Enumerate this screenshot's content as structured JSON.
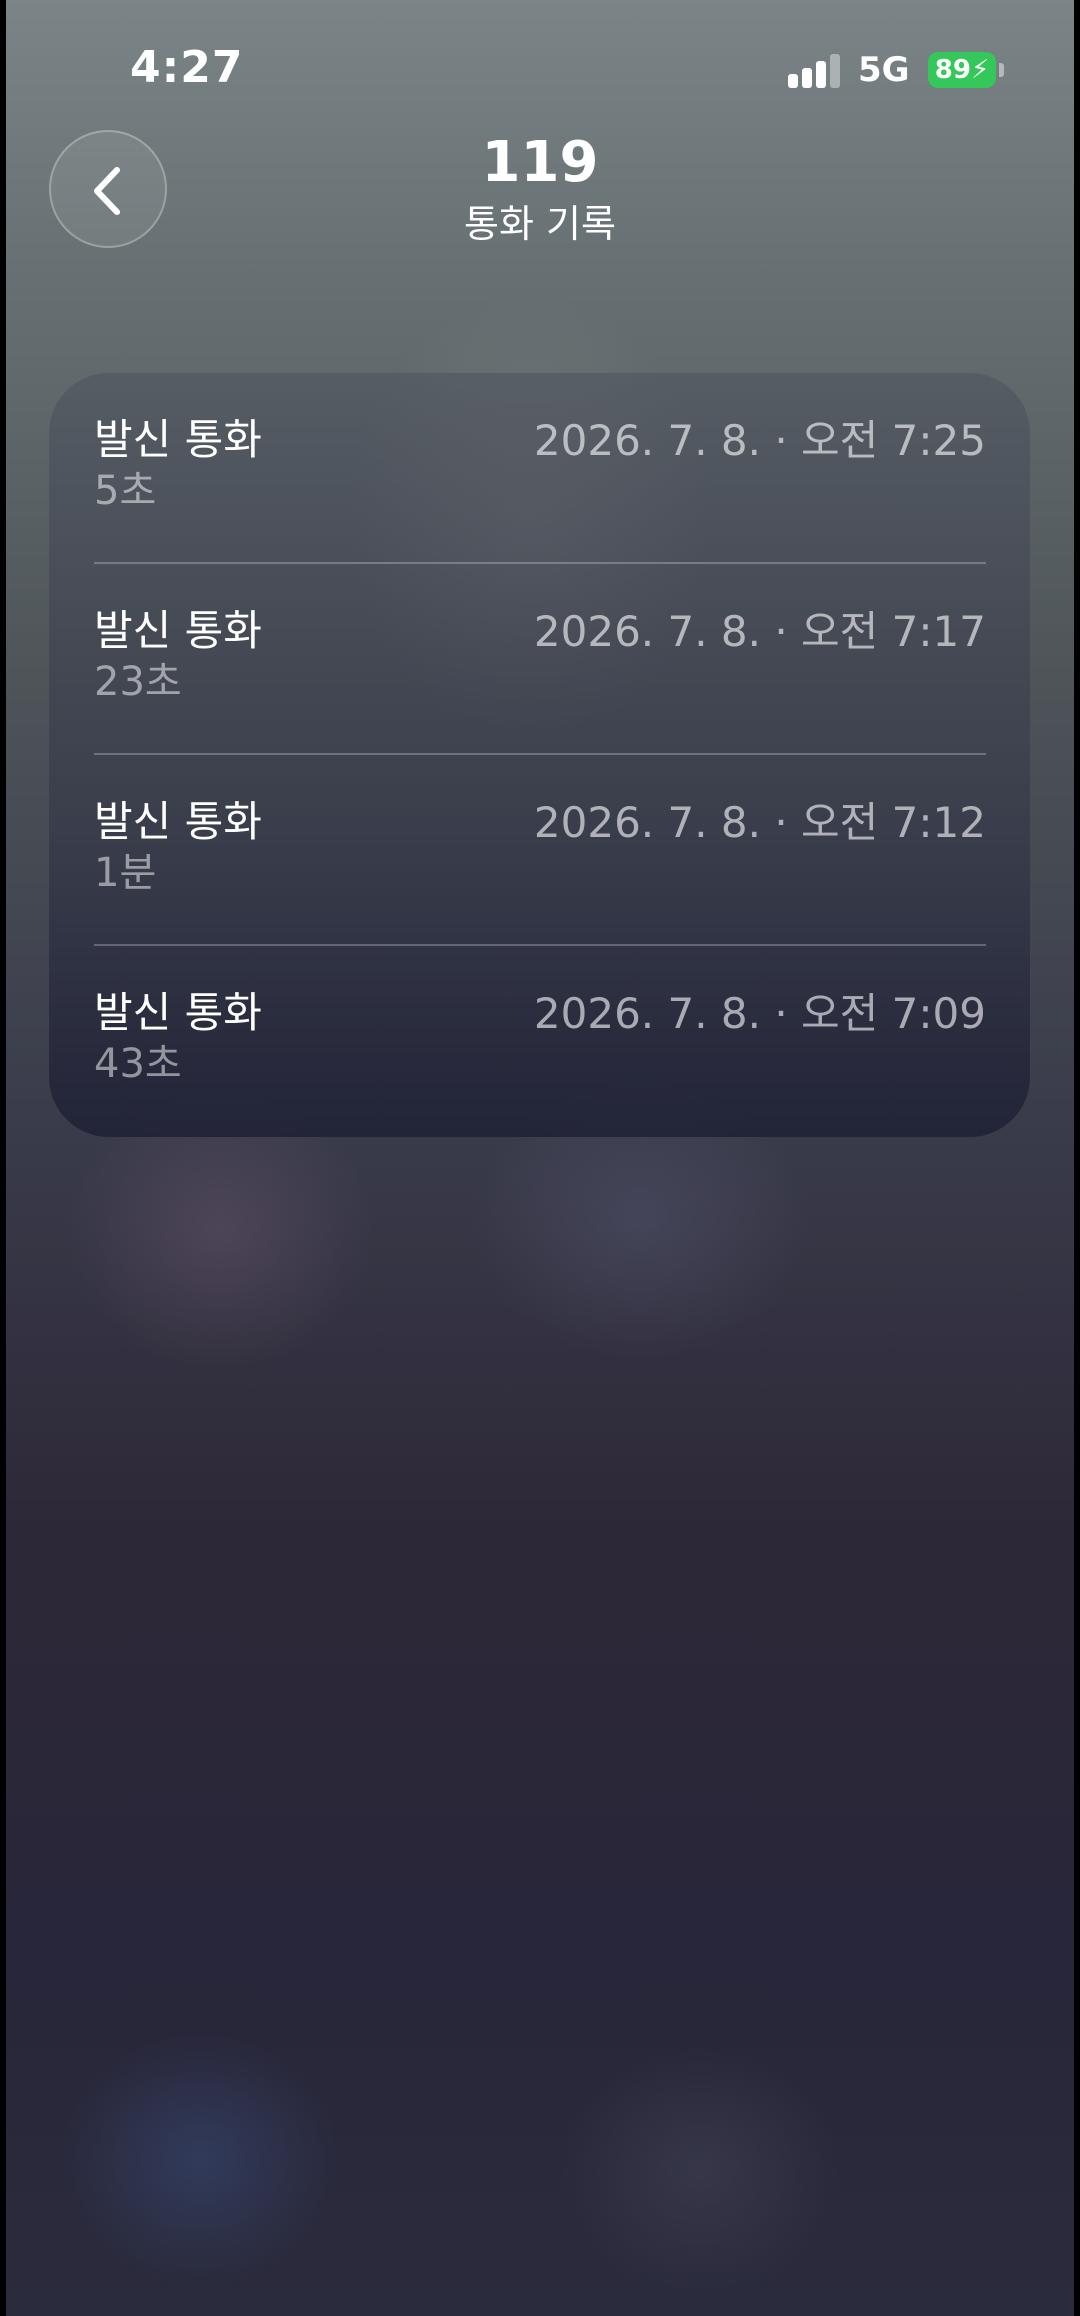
{
  "status_bar": {
    "time": "4:27",
    "network": "5G",
    "battery": "89",
    "battery_color": "#34c759"
  },
  "header": {
    "back_icon": "chevron-left-icon",
    "title": "119",
    "subtitle": "통화 기록"
  },
  "call_log": [
    {
      "type": "발신 통화",
      "duration": "5초",
      "datetime": "2026. 7. 8. · 오전 7:25"
    },
    {
      "type": "발신 통화",
      "duration": "23초",
      "datetime": "2026. 7. 8. · 오전 7:17"
    },
    {
      "type": "발신 통화",
      "duration": "1분",
      "datetime": "2026. 7. 8. · 오전 7:12"
    },
    {
      "type": "발신 통화",
      "duration": "43초",
      "datetime": "2026. 7. 8. · 오전 7:09"
    }
  ]
}
